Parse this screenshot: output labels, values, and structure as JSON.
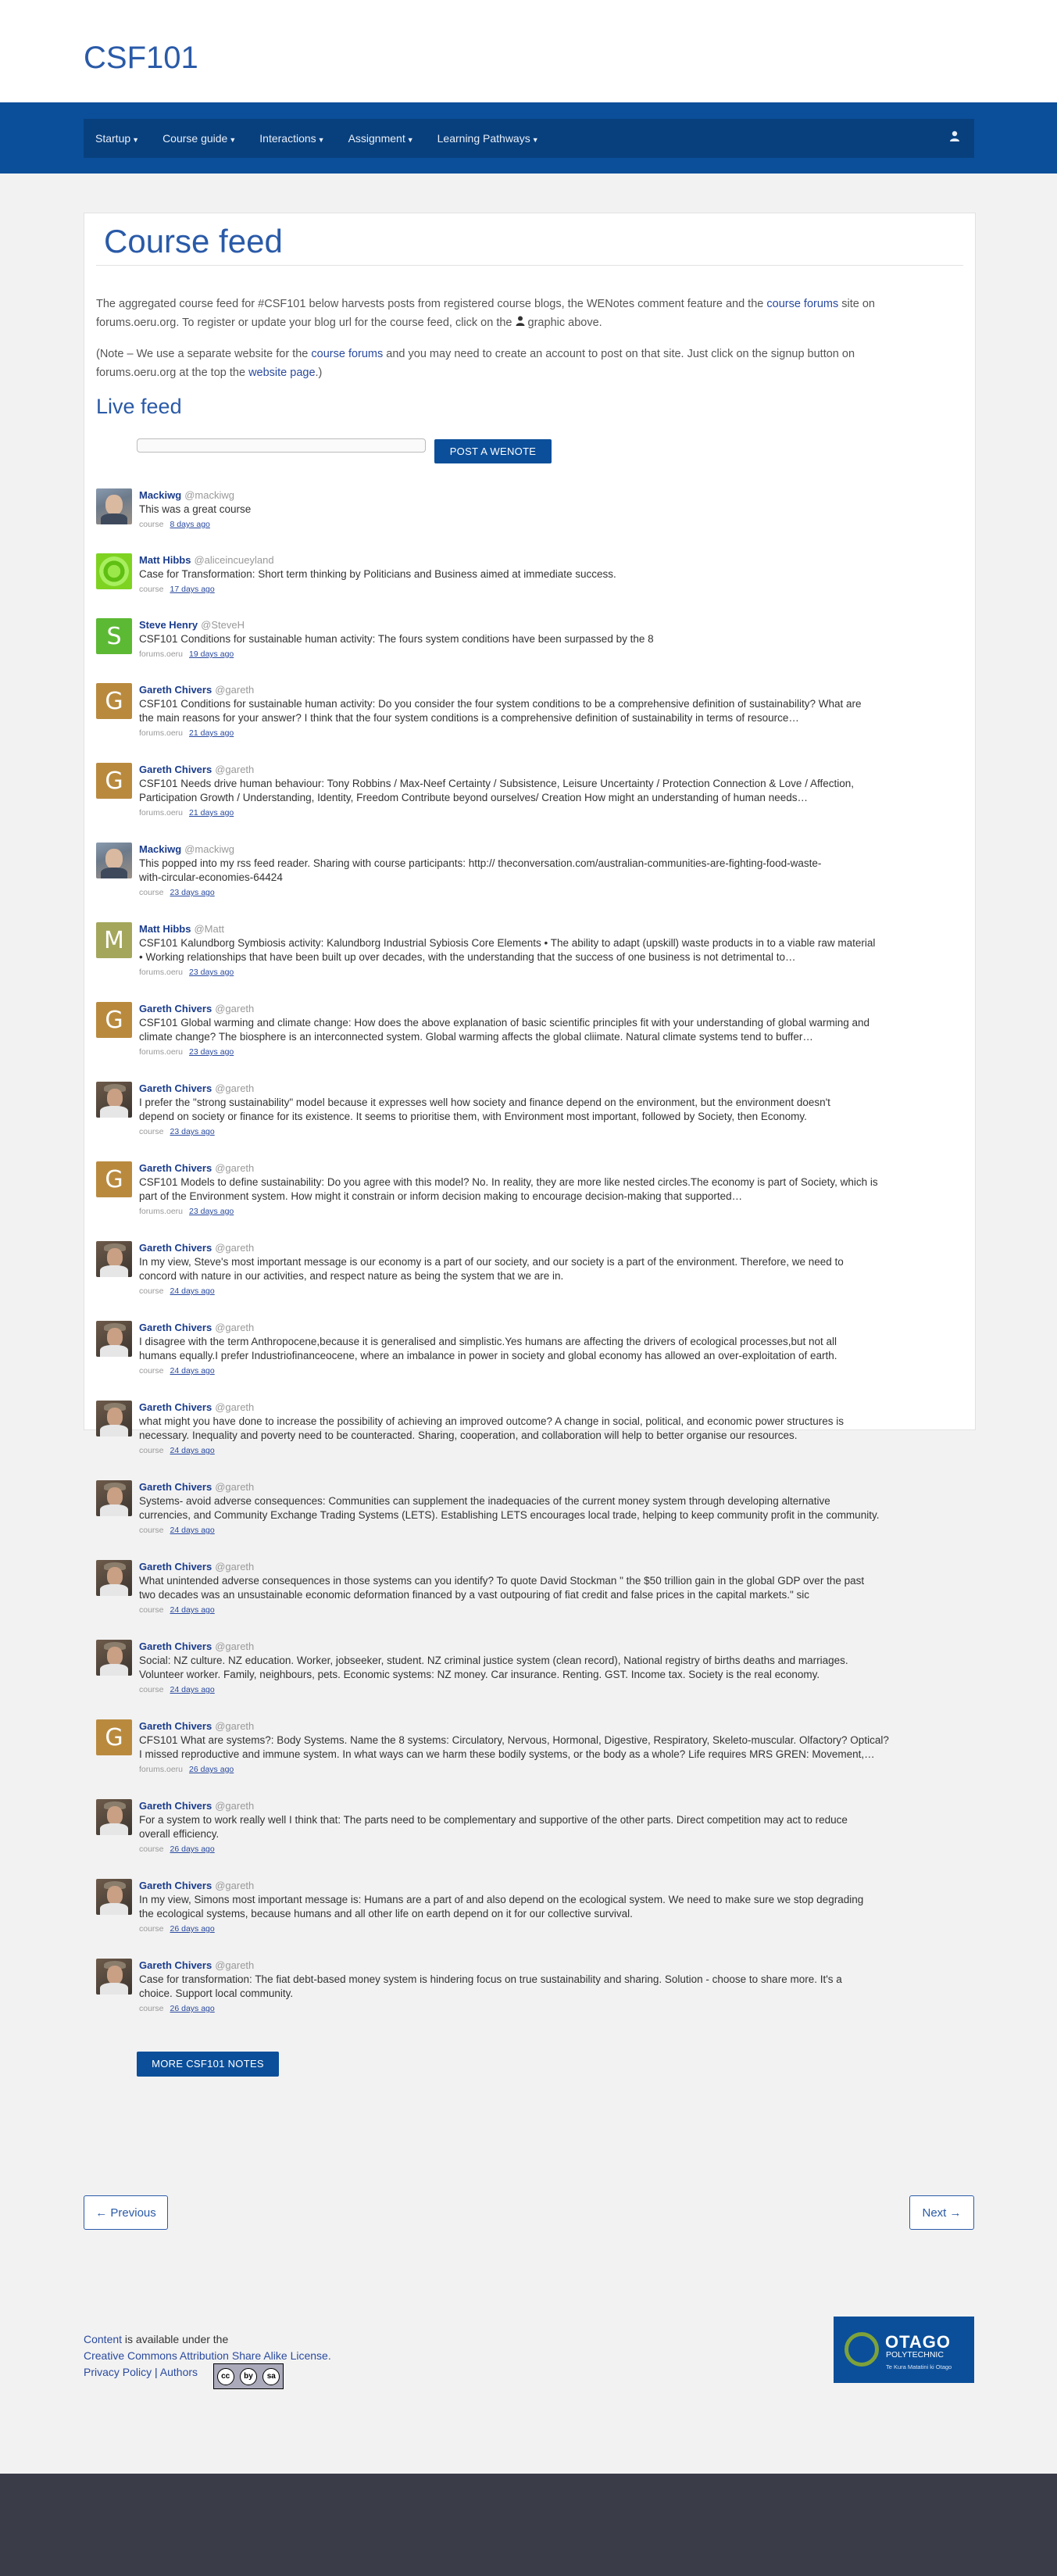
{
  "site": {
    "title": "CSF101"
  },
  "nav": {
    "items": [
      "Startup",
      "Course guide",
      "Interactions",
      "Assignment",
      "Learning Pathways"
    ],
    "user_icon": "user-icon"
  },
  "page": {
    "title": "Course feed",
    "intro1_a": "The aggregated course feed for #CSF101 below harvests posts from registered course blogs, the WENotes comment feature and the ",
    "intro1_link": "course forums",
    "intro1_b": " site on",
    "intro1_c": "forums.oeru.org. To register or update your blog url for the course feed, click on the ",
    "intro1_d": " graphic above.",
    "intro2_a": "(Note – We use a separate website for the ",
    "intro2_link": "course forums",
    "intro2_b": " and you may need to create an account to post on that site. Just click on the signup button on",
    "intro2_c": "forums.oeru.org at the top the ",
    "intro2_link2": "website page",
    "intro2_d": ".)",
    "live_title": "Live feed",
    "post_button": "POST A WENOTE",
    "more_button": "MORE CSF101 NOTES"
  },
  "feed": [
    {
      "avatar": "photo",
      "name": "Mackiwg",
      "handle": "@mackiwg",
      "lines": [
        "This was a great course"
      ],
      "source": "course",
      "time": "8 days ago"
    },
    {
      "avatar": "matt-green",
      "name": "Matt Hibbs",
      "handle": "@aliceincueyland",
      "lines": [
        "Case for Transformation: Short term thinking by Politicians and Business aimed at immediate success."
      ],
      "source": "course",
      "time": "17 days ago"
    },
    {
      "avatar": "S",
      "color": "#5cb934",
      "name": "Steve Henry",
      "handle": "@SteveH",
      "lines": [
        "CSF101 Conditions for sustainable human activity: The fours system conditions have been surpassed by the 8"
      ],
      "source": "forums.oeru",
      "time": "19 days ago"
    },
    {
      "avatar": "G",
      "color": "#b98a3e",
      "name": "Gareth Chivers",
      "handle": "@gareth",
      "lines": [
        "CSF101 Conditions for sustainable human activity: Do you consider the four system conditions to be a comprehensive definition of sustainability? What are",
        "the main reasons for your answer? I think that the four system conditions is a comprehensive definition of sustainability in terms of resource…"
      ],
      "source": "forums.oeru",
      "time": "21 days ago"
    },
    {
      "avatar": "G",
      "color": "#b98a3e",
      "name": "Gareth Chivers",
      "handle": "@gareth",
      "lines": [
        "CSF101 Needs drive human behaviour: Tony Robbins / Max-Neef Certainty / Subsistence, Leisure Uncertainty / Protection Connection & Love / Affection,",
        "Participation Growth / Understanding, Identity, Freedom Contribute beyond ourselves/ Creation How might an understanding of human needs…"
      ],
      "source": "forums.oeru",
      "time": "21 days ago"
    },
    {
      "avatar": "photo",
      "name": "Mackiwg",
      "handle": "@mackiwg",
      "lines": [
        "This popped into my rss feed reader. Sharing with course participants: http:// theconversation.com/australian-communities-are-fighting-food-waste-",
        "with-circular-economies-64424"
      ],
      "source": "course",
      "time": "23 days ago"
    },
    {
      "avatar": "M",
      "color": "#a4a65c",
      "name": "Matt Hibbs",
      "handle": "@Matt",
      "lines": [
        "CSF101 Kalundborg Symbiosis activity: Kalundborg Industrial Sybiosis Core Elements • The ability to adapt (upskill) waste products in to a viable raw material",
        "• Working relationships that have been built up over decades, with the understanding that the success of one business is not detrimental to…"
      ],
      "source": "forums.oeru",
      "time": "23 days ago"
    },
    {
      "avatar": "G",
      "color": "#b98a3e",
      "name": "Gareth Chivers",
      "handle": "@gareth",
      "lines": [
        "CSF101 Global warming and climate change: How does the above explanation of basic scientific principles fit with your understanding of global warming and",
        "climate change? The biosphere is an interconnected system. Global warming affects the global cliimate. Natural climate systems tend to buffer…"
      ],
      "source": "forums.oeru",
      "time": "23 days ago"
    },
    {
      "avatar": "gareth-photo",
      "name": "Gareth Chivers",
      "handle": "@gareth",
      "lines": [
        "I prefer the \"strong sustainability\" model because it expresses well how society and finance depend on the environment, but the environment doesn't",
        "depend on society or finance for its existence. It seems to prioritise them, with Environment most important, followed by Society, then Economy."
      ],
      "source": "course",
      "time": "23 days ago"
    },
    {
      "avatar": "G",
      "color": "#b98a3e",
      "name": "Gareth Chivers",
      "handle": "@gareth",
      "lines": [
        "CSF101 Models to define sustainability: Do you agree with this model? No. In reality, they are more like nested circles.The economy is part of Society, which is",
        "part of the Environment system. How might it constrain or inform decision making to encourage decision-making that supported…"
      ],
      "source": "forums.oeru",
      "time": "23 days ago"
    },
    {
      "avatar": "gareth-photo",
      "name": "Gareth Chivers",
      "handle": "@gareth",
      "lines": [
        "In my view, Steve's most important message is our economy is a part of our society, and our society is a part of the environment. Therefore, we need to",
        "concord with nature in our activities, and respect nature as being the system that we are in."
      ],
      "source": "course",
      "time": "24 days ago"
    },
    {
      "avatar": "gareth-photo",
      "name": "Gareth Chivers",
      "handle": "@gareth",
      "lines": [
        "I disagree with the term Anthropocene,because it is generalised and simplistic.Yes humans are affecting the drivers of ecological processes,but not all",
        "humans equally.I prefer Industriofinanceocene, where an imbalance in power in society and global economy has allowed an over-exploitation of earth."
      ],
      "source": "course",
      "time": "24 days ago"
    },
    {
      "avatar": "gareth-photo",
      "name": "Gareth Chivers",
      "handle": "@gareth",
      "lines": [
        "what might you have done to increase the possibility of achieving an improved outcome? A change in social, political, and economic power structures is",
        "necessary. Inequality and poverty need to be counteracted. Sharing, cooperation, and collaboration will help to better organise our resources."
      ],
      "source": "course",
      "time": "24 days ago"
    },
    {
      "avatar": "gareth-photo",
      "name": "Gareth Chivers",
      "handle": "@gareth",
      "lines": [
        "Systems- avoid adverse consequences: Communities can supplement the inadequacies of the current money system through developing alternative",
        "currencies, and Community Exchange Trading Systems (LETS). Establishing LETS encourages local trade, helping to keep community profit in the community."
      ],
      "source": "course",
      "time": "24 days ago"
    },
    {
      "avatar": "gareth-photo",
      "name": "Gareth Chivers",
      "handle": "@gareth",
      "lines": [
        "What unintended adverse consequences in those systems can you identify? To quote David Stockman \" the $50 trillion gain in the global GDP over the past",
        "two decades was an unsustainable economic deformation financed by a vast outpouring of fiat credit and false prices in the capital markets.\" sic"
      ],
      "source": "course",
      "time": "24 days ago"
    },
    {
      "avatar": "gareth-photo",
      "name": "Gareth Chivers",
      "handle": "@gareth",
      "lines": [
        "Social: NZ culture. NZ education. Worker, jobseeker, student. NZ criminal justice system (clean record), National registry of births deaths and marriages.",
        "Volunteer worker. Family, neighbours, pets. Economic systems: NZ money. Car insurance. Renting. GST. Income tax. Society is the real economy."
      ],
      "source": "course",
      "time": "24 days ago"
    },
    {
      "avatar": "G",
      "color": "#b98a3e",
      "name": "Gareth Chivers",
      "handle": "@gareth",
      "lines": [
        "CFS101 What are systems?: Body Systems. Name the 8 systems: Circulatory, Nervous, Hormonal, Digestive, Respiratory, Skeleto-muscular. Olfactory? Optical?",
        "I missed reproductive and immune system. In what ways can we harm these bodily systems, or the body as a whole? Life requires MRS GREN: Movement,…"
      ],
      "source": "forums.oeru",
      "time": "26 days ago"
    },
    {
      "avatar": "gareth-photo",
      "name": "Gareth Chivers",
      "handle": "@gareth",
      "lines": [
        "For a system to work really well I think that: The parts need to be complementary and supportive of the other parts. Direct competition may act to reduce",
        "overall efficiency."
      ],
      "source": "course",
      "time": "26 days ago"
    },
    {
      "avatar": "gareth-photo",
      "name": "Gareth Chivers",
      "handle": "@gareth",
      "lines": [
        "In my view, Simons most important message is: Humans are a part of and also depend on the ecological system. We need to make sure we stop degrading",
        "the ecological systems, because humans and all other life on earth depend on it for our collective survival."
      ],
      "source": "course",
      "time": "26 days ago"
    },
    {
      "avatar": "gareth-photo",
      "name": "Gareth Chivers",
      "handle": "@gareth",
      "lines": [
        "Case for transformation: The fiat debt-based money system is hindering focus on true sustainability and sharing. Solution - choose to share more. It's a",
        "choice. Support local community."
      ],
      "source": "course",
      "time": "26 days ago"
    }
  ],
  "pager": {
    "previous": "← Previous",
    "next": "Next →"
  },
  "footer": {
    "content_link": "Content",
    "content_text": " is available under the",
    "license_link": "Creative Commons Attribution Share Alike License.",
    "privacy": "Privacy Policy",
    "separator": "|",
    "authors": "Authors",
    "cc_icons": [
      "cc",
      "by",
      "sa"
    ]
  },
  "logo": {
    "name": "OTAGO",
    "sub": "POLYTECHNIC",
    "tag": "Te Kura Matatini ki Otago"
  }
}
